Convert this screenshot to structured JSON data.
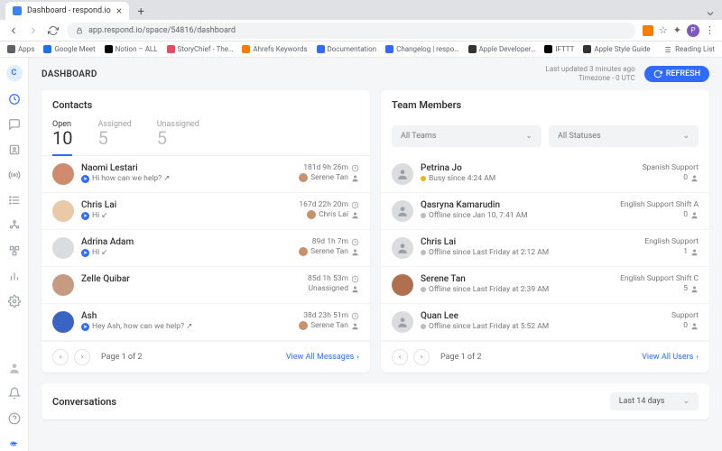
{
  "browser": {
    "tab_title": "Dashboard - respond.io",
    "url": "app.respond.io/space/54816/dashboard",
    "bookmarks": [
      {
        "label": "Apps",
        "color": "#5f6368"
      },
      {
        "label": "Google Meet",
        "color": "#1a73e8"
      },
      {
        "label": "Notion – ALL",
        "color": "#000"
      },
      {
        "label": "StoryChief - The…",
        "color": "#e04f5f"
      },
      {
        "label": "Ahrefs Keywords",
        "color": "#ff7a00"
      },
      {
        "label": "Documentation",
        "color": "#2f6bff"
      },
      {
        "label": "Changelog | respo…",
        "color": "#2f6bff"
      },
      {
        "label": "Apple Developer…",
        "color": "#333"
      },
      {
        "label": "IFTTT",
        "color": "#000"
      },
      {
        "label": "Apple Style Guide",
        "color": "#333"
      }
    ],
    "reading_list": "Reading List"
  },
  "header": {
    "title": "DASHBOARD",
    "last_updated": "Last updated 3 minutes ago",
    "timezone": "Timezone - 0 UTC",
    "refresh": "REFRESH"
  },
  "contacts": {
    "title": "Contacts",
    "tabs": [
      {
        "label": "Open",
        "count": "10",
        "active": true
      },
      {
        "label": "Assigned",
        "count": "5",
        "active": false
      },
      {
        "label": "Unassigned",
        "count": "5",
        "active": false
      }
    ],
    "items": [
      {
        "name": "Naomi Lestari",
        "msg": "Hi how can we help? ↗",
        "time": "181d 9h 26m",
        "assignee": "Serene Tan",
        "av": "#d08a6e"
      },
      {
        "name": "Chris Lai",
        "msg": "Hi ↙",
        "time": "167d 22h 20m",
        "assignee": "Chris Lai",
        "av": "#e9c9a8"
      },
      {
        "name": "Adrina Adam",
        "msg": "Hi ↙",
        "time": "89d 1h 7m",
        "assignee": "Serene Tan",
        "av": "#dadce0"
      },
      {
        "name": "Zelle Quibar",
        "msg": "",
        "time": "85d 1h 53m",
        "assignee": "Unassigned",
        "av": "#c79a82"
      },
      {
        "name": "Ash",
        "msg": "Hey Ash, how can we help? ↗",
        "time": "38d 23h 51m",
        "assignee": "Serene Tan",
        "av": "#3b63c4"
      }
    ],
    "pager": "Page 1 of 2",
    "viewall": "View All Messages"
  },
  "team": {
    "title": "Team Members",
    "filter_team": "All Teams",
    "filter_status": "All Statuses",
    "items": [
      {
        "name": "Petrina Jo",
        "status": "Busy since 4:24 AM",
        "dot": "#f4b400",
        "team": "Spanish Support",
        "count": "0",
        "av": "#dadce0"
      },
      {
        "name": "Qasryna Kamarudin",
        "status": "Offline since Jan 10, 7:41 AM",
        "dot": "#bdbdbd",
        "team": "English Support Shift A",
        "count": "0",
        "av": "#dadce0"
      },
      {
        "name": "Chris Lai",
        "status": "Offline since Last Friday at 2:12 AM",
        "dot": "#bdbdbd",
        "team": "English Support",
        "count": "1",
        "av": "#dadce0"
      },
      {
        "name": "Serene Tan",
        "status": "Offline since Last Friday at 2:39 AM",
        "dot": "#bdbdbd",
        "team": "English Support Shift C",
        "count": "5",
        "av": "#b07050"
      },
      {
        "name": "Quan Lee",
        "status": "Offline since Last Friday at 5:52 AM",
        "dot": "#bdbdbd",
        "team": "Support",
        "count": "0",
        "av": "#dadce0"
      }
    ],
    "pager": "Page 1 of 2",
    "viewall": "View All Users"
  },
  "conversations": {
    "title": "Conversations",
    "period": "Last 14 days"
  }
}
